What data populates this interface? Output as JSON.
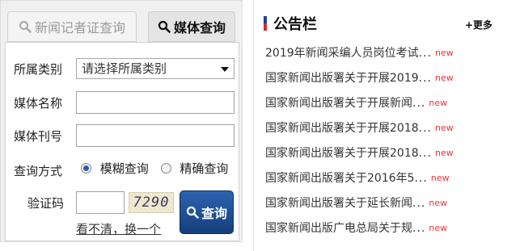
{
  "search": {
    "tabs": [
      {
        "label": "新闻记者证查询",
        "active": false
      },
      {
        "label": "媒体查询",
        "active": true
      }
    ],
    "form": {
      "category_label": "所属类别",
      "category_placeholder": "请选择所属类别",
      "name_label": "媒体名称",
      "name_value": "",
      "issue_label": "媒体刊号",
      "issue_value": "",
      "mode_label": "查询方式",
      "mode_fuzzy": "模糊查询",
      "mode_exact": "精确查询",
      "mode_selected": "模糊查询",
      "captcha_label": "验证码",
      "captcha_value": "",
      "captcha_code": "7290",
      "refresh_link": "看不清，换一个",
      "query_button": "查询"
    }
  },
  "bulletin": {
    "title": "公告栏",
    "more": "+更多",
    "badge": "new",
    "items": [
      {
        "text": "2019年新闻采编人员岗位考试",
        "ellipsis": "..."
      },
      {
        "text": "国家新闻出版署关于开展2019",
        "ellipsis": "..."
      },
      {
        "text": "国家新闻出版署关于开展新闻",
        "ellipsis": "..."
      },
      {
        "text": "国家新闻出版署关于开展2018",
        "ellipsis": "..."
      },
      {
        "text": "国家新闻出版署关于开展2018",
        "ellipsis": "..."
      },
      {
        "text": "国家新闻出版署关于2016年5",
        "ellipsis": "..."
      },
      {
        "text": "国家新闻出版署关于延长新闻",
        "ellipsis": "..."
      },
      {
        "text": "国家新闻出版广电总局关于规",
        "ellipsis": "..."
      }
    ]
  },
  "colors": {
    "accent_blue": "#1f4f96",
    "new_badge": "#e8333a",
    "title_bar_top": "#1f3f9e",
    "title_bar_bottom": "#d22a2a"
  },
  "icons": {
    "tab_search": "search-icon",
    "button_search": "search-icon",
    "select_arrow": "caret-down-icon"
  }
}
